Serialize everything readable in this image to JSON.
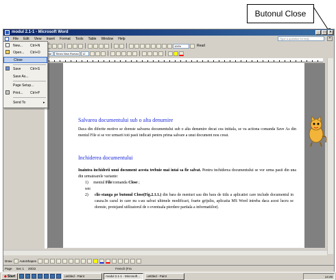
{
  "callout": {
    "label": "Butonul Close"
  },
  "window": {
    "title": "modul 2.1-1 - Microsoft Word"
  },
  "menubar": {
    "items": [
      "File",
      "Edit",
      "View",
      "Insert",
      "Format",
      "Tools",
      "Table",
      "Window",
      "Help"
    ],
    "help_placeholder": "Type a question for help"
  },
  "toolbar": {
    "style": "Normal",
    "font": "Times New Roman",
    "size": "12",
    "zoom": "100%",
    "read": "Read"
  },
  "file_menu": {
    "items": [
      {
        "label": "New...",
        "shortcut": "Ctrl+N"
      },
      {
        "label": "Open...",
        "shortcut": "Ctrl+O"
      },
      {
        "label": "Close",
        "shortcut": ""
      },
      {
        "label": "Save",
        "shortcut": "Ctrl+S"
      },
      {
        "label": "Save As...",
        "shortcut": ""
      },
      {
        "label": "Page Setup...",
        "shortcut": ""
      },
      {
        "label": "Print...",
        "shortcut": "Ctrl+P"
      },
      {
        "label": "Send To",
        "shortcut": ""
      }
    ]
  },
  "document": {
    "heading1": "Salvarea documentului sub o alta denumire",
    "para1": "Daca din diferite motive se doreste salvarea documentului sub o alta denumire decat cea initiala, se va actiona comanda Save As din meniul File si se vor urmarii toti pasii indicati pentru prima salvare a unui document nou creat.",
    "heading2": "Inchiderea documentului",
    "para2_bold": "Inaintea inchiderii unui document acesta trebuie mai intai sa fie salvat.",
    "para2_rest": " Pentru inchiderea documentului se vor urma pasii din una din urmatoarele variante:",
    "item1_num": "1)",
    "item1_pre": "meniul ",
    "item1_b1": "File",
    "item1_mid": "/comanda ",
    "item1_b2": "Close",
    "item1_end": " ;",
    "or": "sau",
    "item2_num": "2)",
    "item2_bold": "clic-stanga pe butonul Close(Fig.2.1.1.)",
    "item2_rest": " din bara de meniuri sau din bara de titlu a aplicatiei care include documentul in cauza.In cazul in care nu s-au salvat ultimele modificari, foarte grijuliu, aplicatia MS Word intreba daca acest lucru se doreste, protejand utilizatorul de o eventuala pierdere partiala a informatiilor(."
  },
  "drawbar": {
    "draw": "Draw",
    "autoshapes": "AutoShapes"
  },
  "statusbar": {
    "page": "Page",
    "section": "Sec 1",
    "pages": "20/22",
    "language": "French (Fra"
  },
  "taskbar": {
    "start": "Start",
    "tasks": [
      "untitled - Paint",
      "modul 2.1-1 - Microsoft...",
      "untitled - Paint"
    ],
    "clock": "14:49"
  }
}
